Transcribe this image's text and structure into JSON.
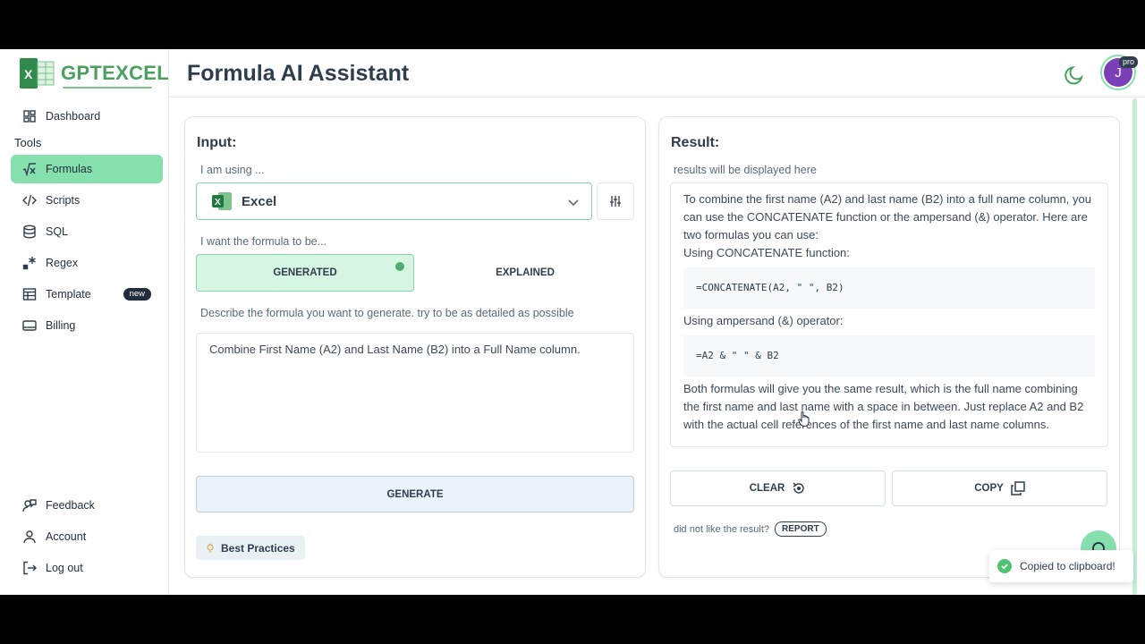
{
  "app": {
    "logo_text": "GPTEXCEL",
    "page_title": "Formula AI Assistant",
    "avatar_initial": "J",
    "pro_badge": "pro",
    "accent_color": "#86e0ae",
    "brand_color": "#49a05f"
  },
  "sidebar": {
    "dashboard": {
      "label": "Dashboard",
      "icon": "grid-icon"
    },
    "tools_heading": "Tools",
    "items": [
      {
        "label": "Formulas",
        "icon": "square-root-icon",
        "active": true
      },
      {
        "label": "Scripts",
        "icon": "code-icon"
      },
      {
        "label": "SQL",
        "icon": "database-icon"
      },
      {
        "label": "Regex",
        "icon": "regex-icon"
      },
      {
        "label": "Template",
        "icon": "table-icon",
        "badge": "new"
      },
      {
        "label": "Billing",
        "icon": "credit-card-icon"
      }
    ],
    "bottom": [
      {
        "label": "Feedback",
        "icon": "feedback-icon"
      },
      {
        "label": "Account",
        "icon": "user-icon"
      },
      {
        "label": "Log out",
        "icon": "logout-icon"
      }
    ]
  },
  "input": {
    "title": "Input:",
    "using_hint": "I am using ...",
    "selected_app": "Excel",
    "mode_hint": "I want the formula to be...",
    "mode_generated": "GENERATED",
    "mode_explained": "EXPLAINED",
    "describe_hint": "Describe the formula you want to generate. try to be as detailed as possible",
    "prompt_value": "Combine First Name (A2) and Last Name (B2) into a Full Name column.",
    "generate_label": "GENERATE",
    "best_practices_label": "Best Practices"
  },
  "result": {
    "title": "Result:",
    "placeholder_hint": "results will be displayed here",
    "intro": "To combine the first name (A2) and last name (B2) into a full name column, you can use the CONCATENATE function or the ampersand (&) operator. Here are two formulas you can use:",
    "label_concat": "Using CONCATENATE function:",
    "code_concat": "=CONCATENATE(A2, \" \", B2)",
    "label_amp": "Using ampersand (&) operator:",
    "code_amp": "=A2 & \" \" & B2",
    "outro": "Both formulas will give you the same result, which is the full name combining the first name and last name with a space in between. Just replace A2 and B2 with the actual cell references of the first name and last name columns.",
    "clear_label": "CLEAR",
    "copy_label": "COPY",
    "feedback_text": "did not like the result?",
    "report_label": "REPORT"
  },
  "toast": {
    "message": "Copied to clipboard!"
  }
}
